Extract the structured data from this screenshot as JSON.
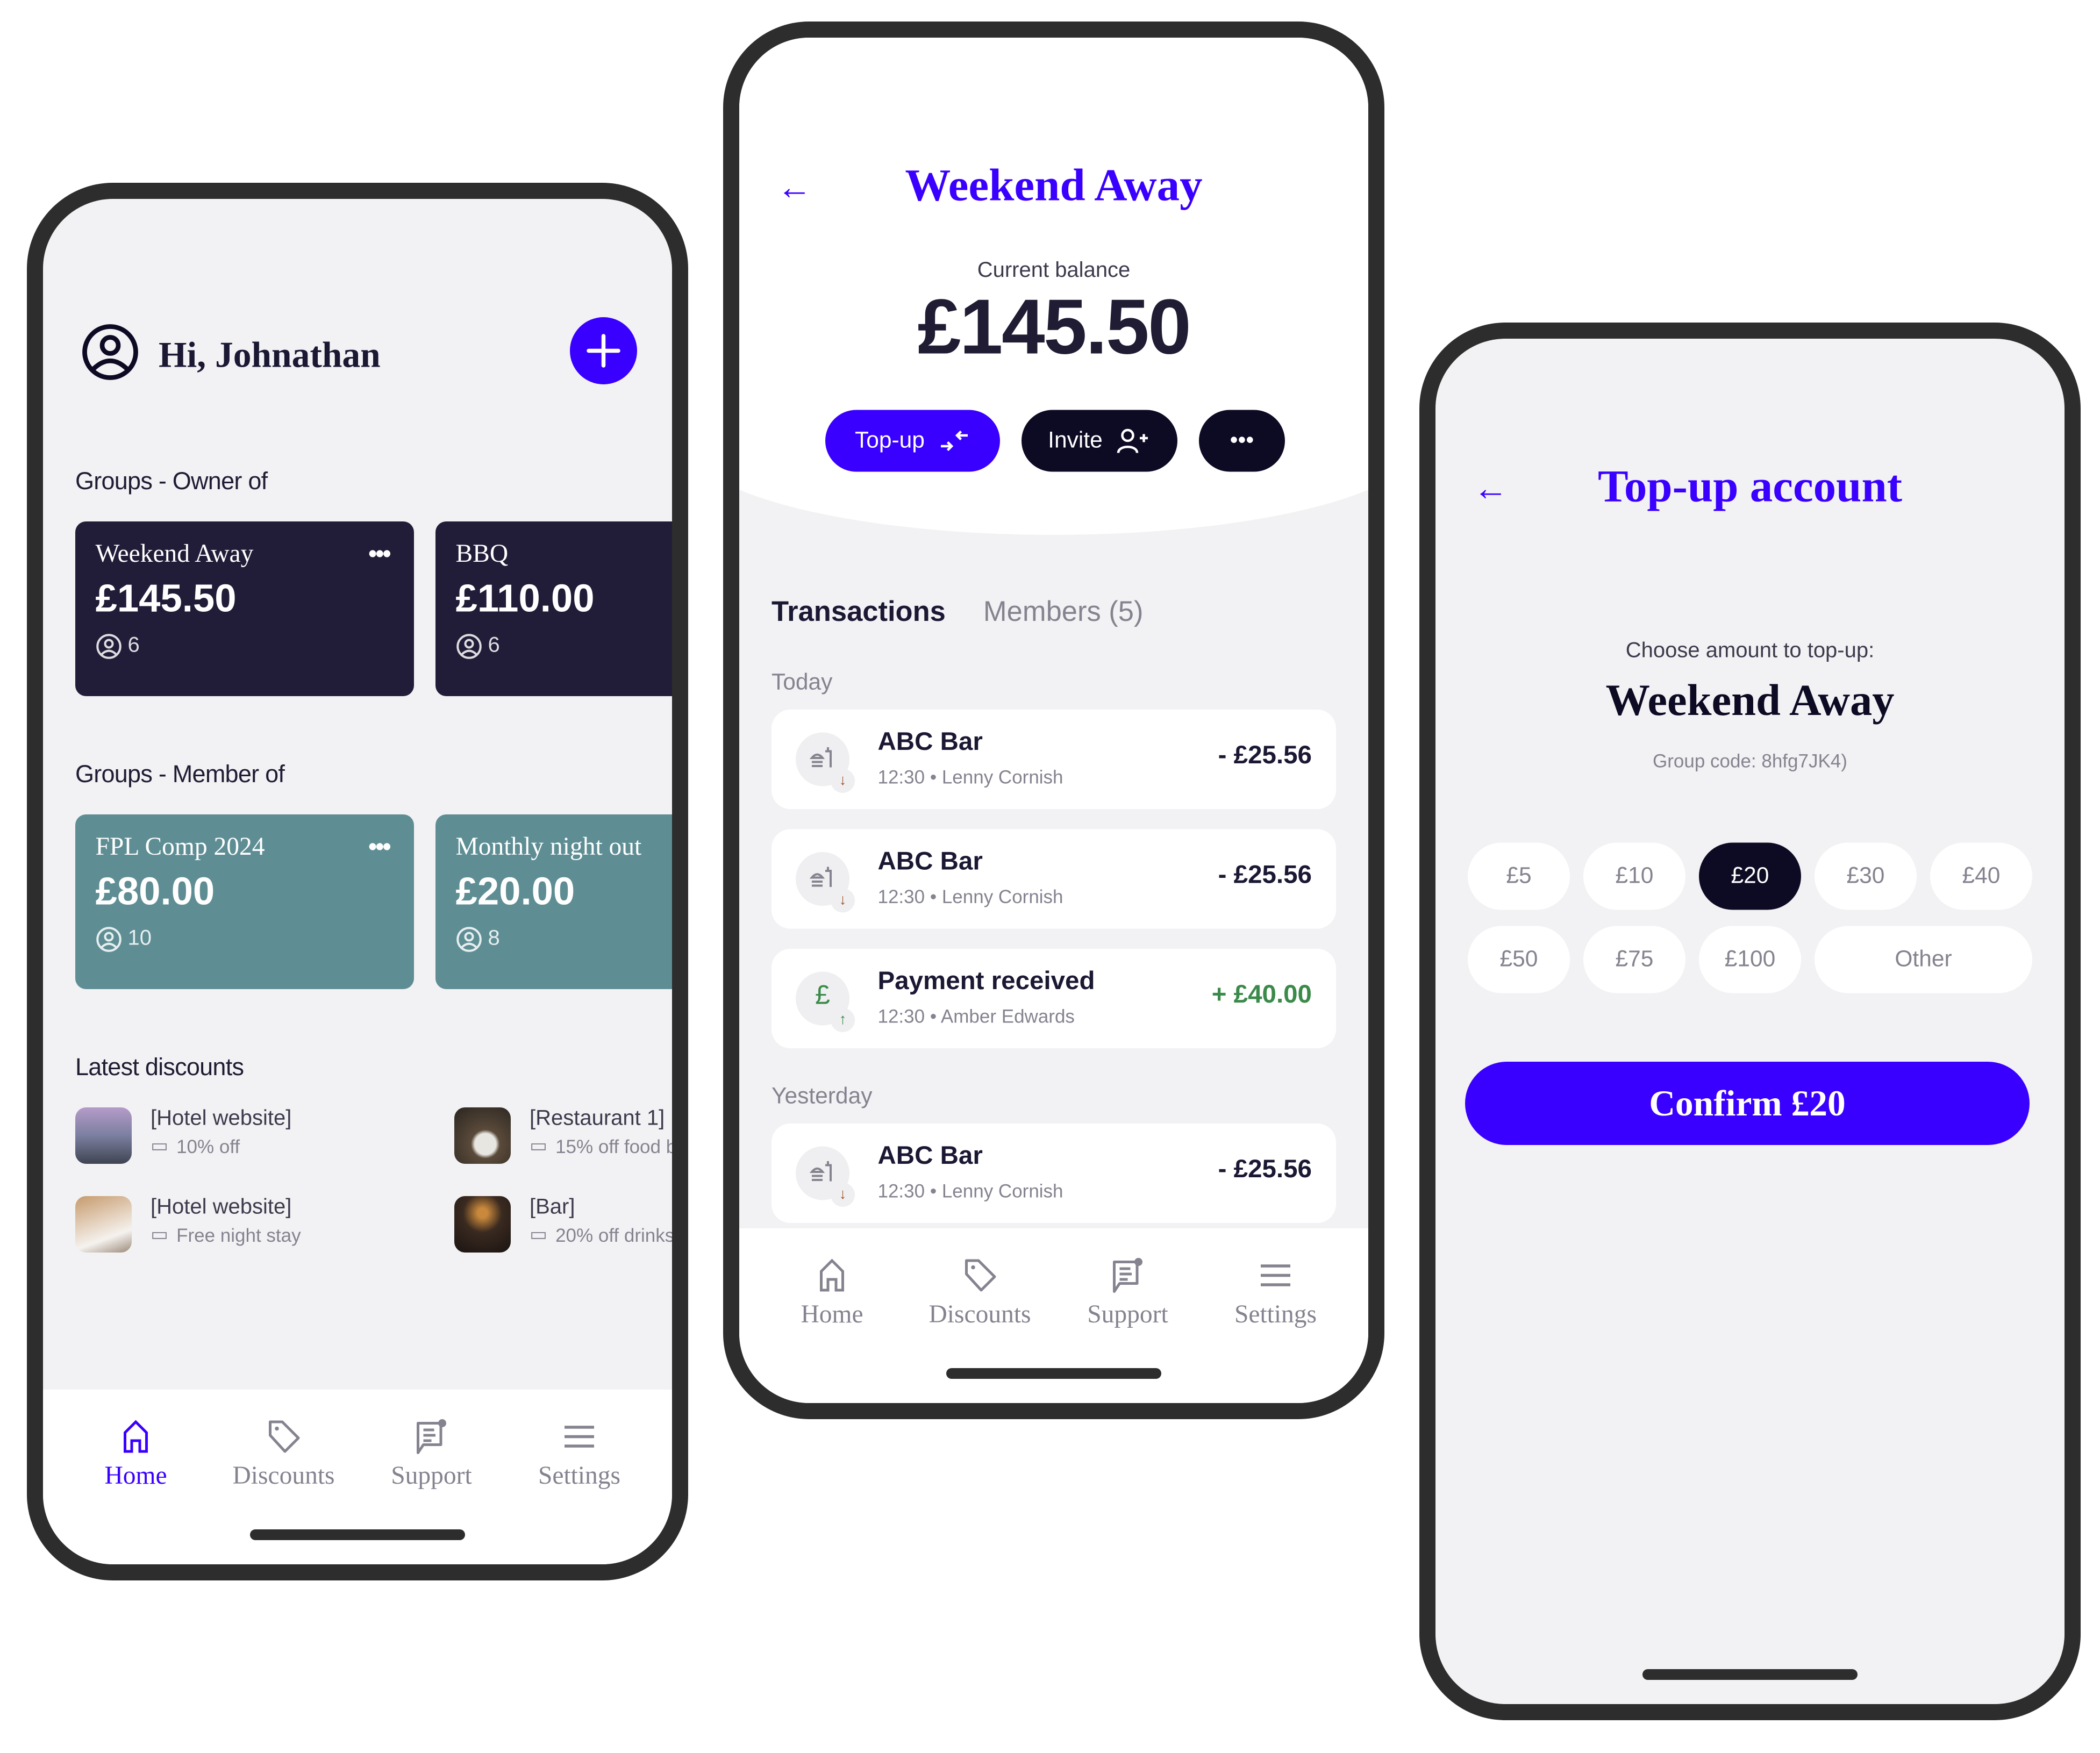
{
  "home": {
    "greeting": "Hi, Johnathan",
    "owner_section": "Groups - Owner of",
    "owner_groups": [
      {
        "name": "Weekend Away",
        "amount": "£145.50",
        "members": "6"
      },
      {
        "name": "BBQ",
        "amount": "£110.00",
        "members": "6"
      }
    ],
    "member_section": "Groups - Member of",
    "member_groups": [
      {
        "name": "FPL Comp 2024",
        "amount": "£80.00",
        "members": "10"
      },
      {
        "name": "Monthly night out",
        "amount": "£20.00",
        "members": "8"
      }
    ],
    "discounts_section": "Latest discounts",
    "discounts": [
      {
        "title": "[Hotel website]",
        "offer": "10% off"
      },
      {
        "title": "[Restaurant 1]",
        "offer": "15% off food b"
      },
      {
        "title": "[Hotel website]",
        "offer": "Free night stay"
      },
      {
        "title": "[Bar]",
        "offer": "20% off drinks"
      }
    ]
  },
  "nav": {
    "items": [
      {
        "label": "Home",
        "icon": "home-icon"
      },
      {
        "label": "Discounts",
        "icon": "tag-icon"
      },
      {
        "label": "Support",
        "icon": "support-chat-icon"
      },
      {
        "label": "Settings",
        "icon": "menu-icon"
      }
    ]
  },
  "group": {
    "title": "Weekend Away",
    "balance_label": "Current balance",
    "balance": "£145.50",
    "topup_label": "Top-up",
    "invite_label": "Invite",
    "more_label": "•••",
    "tabs": [
      "Transactions",
      "Members (5)"
    ],
    "today_label": "Today",
    "yesterday_label": "Yesterday",
    "transactions_today": [
      {
        "title": "ABC Bar",
        "time": "12:30",
        "person": "Lenny Cornish",
        "amount": "- £25.56",
        "type": "debit"
      },
      {
        "title": "ABC Bar",
        "time": "12:30",
        "person": "Lenny Cornish",
        "amount": "- £25.56",
        "type": "debit"
      },
      {
        "title": "Payment received",
        "time": "12:30",
        "person": "Amber Edwards",
        "amount": "+ £40.00",
        "type": "credit"
      }
    ],
    "transactions_yesterday": [
      {
        "title": "ABC Bar",
        "time": "12:30",
        "person": "Lenny Cornish",
        "amount": "- £25.56",
        "type": "debit"
      }
    ]
  },
  "topup": {
    "title": "Top-up account",
    "prompt": "Choose amount to top-up:",
    "group_name": "Weekend Away",
    "group_code": "Group code: 8hfg7JK4)",
    "amounts": [
      "£5",
      "£10",
      "£20",
      "£30",
      "£40",
      "£50",
      "£75",
      "£100",
      "Other"
    ],
    "selected": "£20",
    "confirm_label": "Confirm £20"
  },
  "colors": {
    "accent": "#3a00ff",
    "dark": "#211d38",
    "teal": "#5e8e94",
    "credit": "#3a8a4a",
    "debit_arrow": "#a0522d"
  }
}
